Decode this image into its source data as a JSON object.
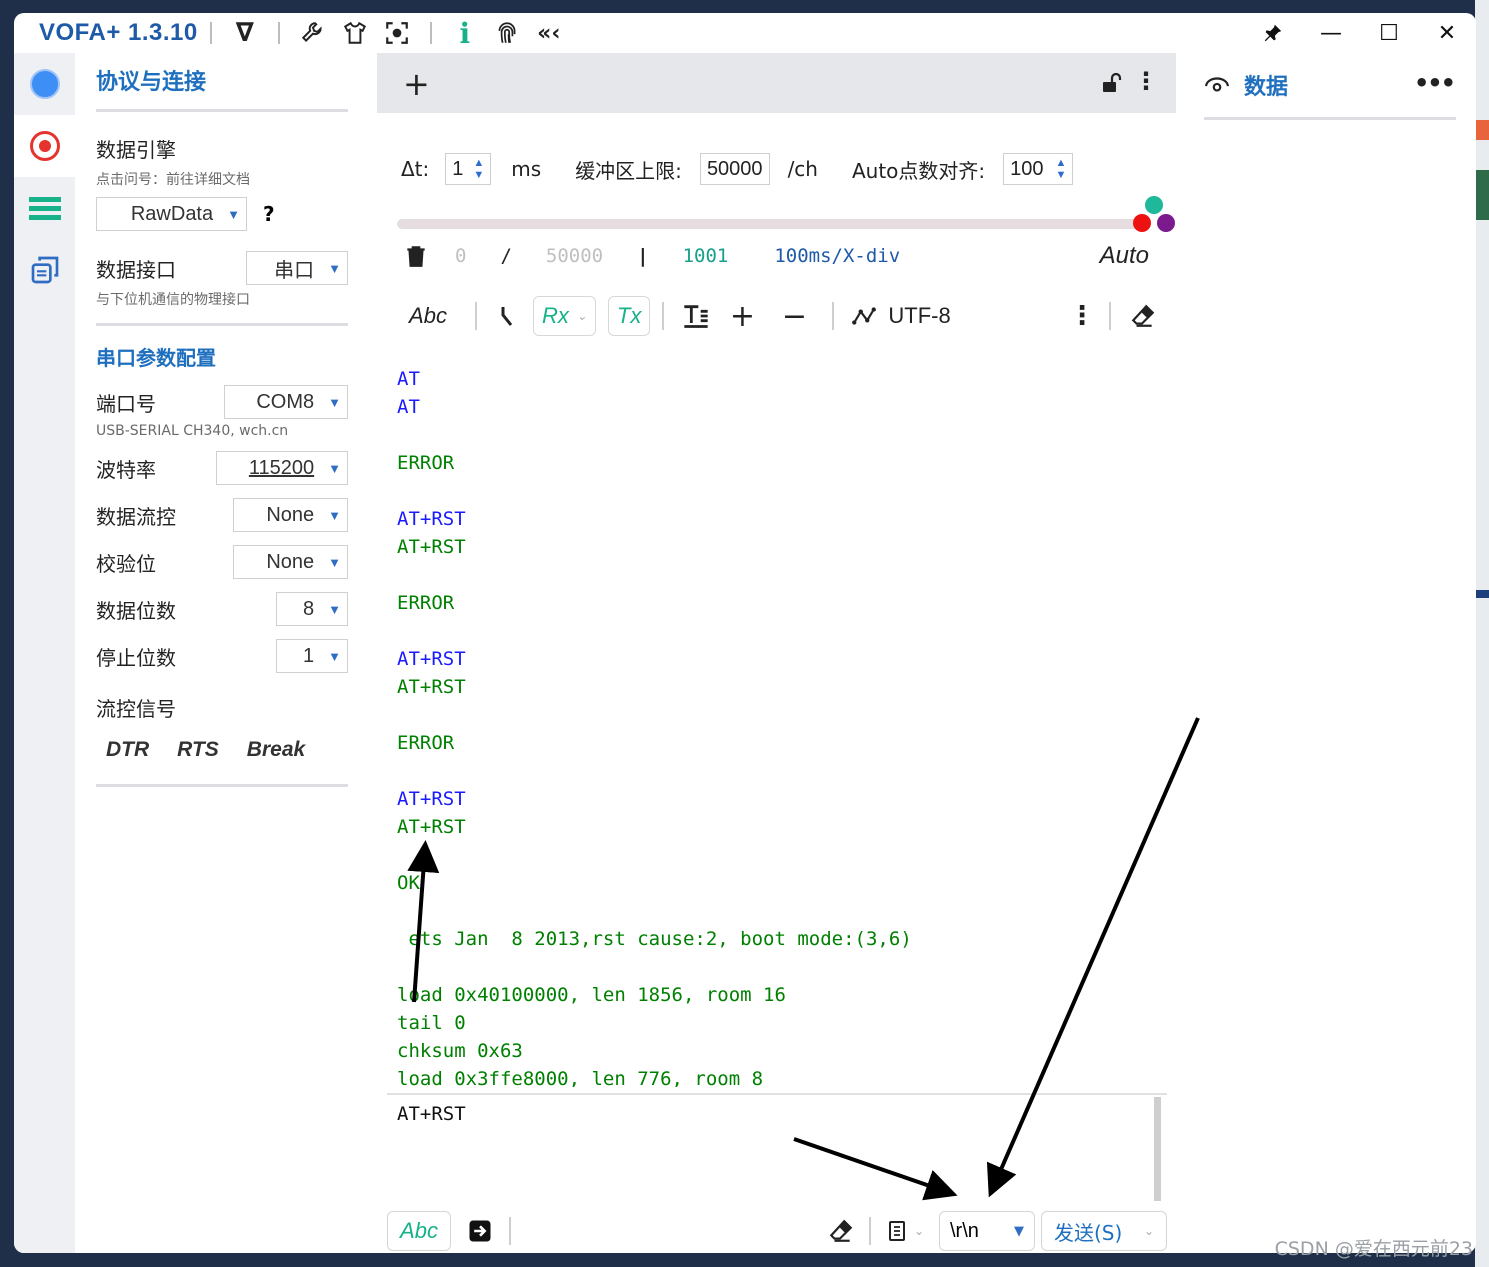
{
  "app": {
    "title": "VOFA+ 1.3.10"
  },
  "titlebar_icons": [
    "vofa-logo-icon",
    "wrench-icon",
    "shirt-icon",
    "screenshot-icon",
    "info-icon",
    "fingerprint-icon",
    "collapse-icon"
  ],
  "protocol_panel": {
    "title": "协议与连接",
    "engine_label": "数据引擎",
    "engine_hint": "点击问号：前往详细文档",
    "engine_value": "RawData",
    "help": "?",
    "interface_label": "数据接口",
    "interface_value": "串口",
    "interface_hint": "与下位机通信的物理接口",
    "serial_title": "串口参数配置",
    "port_label": "端口号",
    "port_value": "COM8",
    "port_hint": "USB-SERIAL CH340, wch.cn",
    "baud_label": "波特率",
    "baud_value": "115200",
    "flow_label": "数据流控",
    "flow_value": "None",
    "parity_label": "校验位",
    "parity_value": "None",
    "databits_label": "数据位数",
    "databits_value": "8",
    "stopbits_label": "停止位数",
    "stopbits_value": "1",
    "signals_label": "流控信号",
    "signals": [
      "DTR",
      "RTS",
      "Break"
    ]
  },
  "params": {
    "dt_label": "Δt:",
    "dt_value": "1",
    "dt_unit": "ms",
    "buffer_label": "缓冲区上限:",
    "buffer_value": "50000",
    "buffer_unit": "/ch",
    "auto_align_label": "Auto点数对齐:",
    "auto_align_value": "100"
  },
  "stats": {
    "count": "0",
    "slash": "/",
    "capacity": "50000",
    "bar": "|",
    "points": "1001",
    "div": "100ms/X-div",
    "mode": "Auto"
  },
  "toolbar": {
    "abc": "Abc",
    "rx": "Rx",
    "tx": "Tx",
    "encoding": "UTF-8"
  },
  "console_lines": [
    {
      "text": "AT",
      "color": "#1a1aff"
    },
    {
      "text": "AT",
      "color": "#1a1aff"
    },
    {
      "text": "",
      "color": "#008000"
    },
    {
      "text": "ERROR",
      "color": "#008000"
    },
    {
      "text": "",
      "color": "#008000"
    },
    {
      "text": "AT+RST",
      "color": "#1a1aff"
    },
    {
      "text": "AT+RST",
      "color": "#008000"
    },
    {
      "text": "",
      "color": "#008000"
    },
    {
      "text": "ERROR",
      "color": "#008000"
    },
    {
      "text": "",
      "color": "#008000"
    },
    {
      "text": "AT+RST",
      "color": "#1a1aff"
    },
    {
      "text": "AT+RST",
      "color": "#008000"
    },
    {
      "text": "",
      "color": "#008000"
    },
    {
      "text": "ERROR",
      "color": "#008000"
    },
    {
      "text": "",
      "color": "#008000"
    },
    {
      "text": "AT+RST",
      "color": "#1a1aff"
    },
    {
      "text": "AT+RST",
      "color": "#008000"
    },
    {
      "text": "",
      "color": "#008000"
    },
    {
      "text": "OK",
      "color": "#008000"
    },
    {
      "text": "",
      "color": "#008000"
    },
    {
      "text": " ets Jan  8 2013,rst cause:2, boot mode:(3,6)",
      "color": "#008000"
    },
    {
      "text": "",
      "color": "#008000"
    },
    {
      "text": "load 0x40100000, len 1856, room 16",
      "color": "#008000"
    },
    {
      "text": "tail 0",
      "color": "#008000"
    },
    {
      "text": "chksum 0x63",
      "color": "#008000"
    },
    {
      "text": "load 0x3ffe8000, len 776, room 8",
      "color": "#008000"
    }
  ],
  "send": {
    "text": "AT+RST",
    "abc": "Abc",
    "line_ending": "\\r\\n",
    "send_label": "发送(S)"
  },
  "data_panel": {
    "title": "数据"
  },
  "watermark": "CSDN @爱在西元前23"
}
